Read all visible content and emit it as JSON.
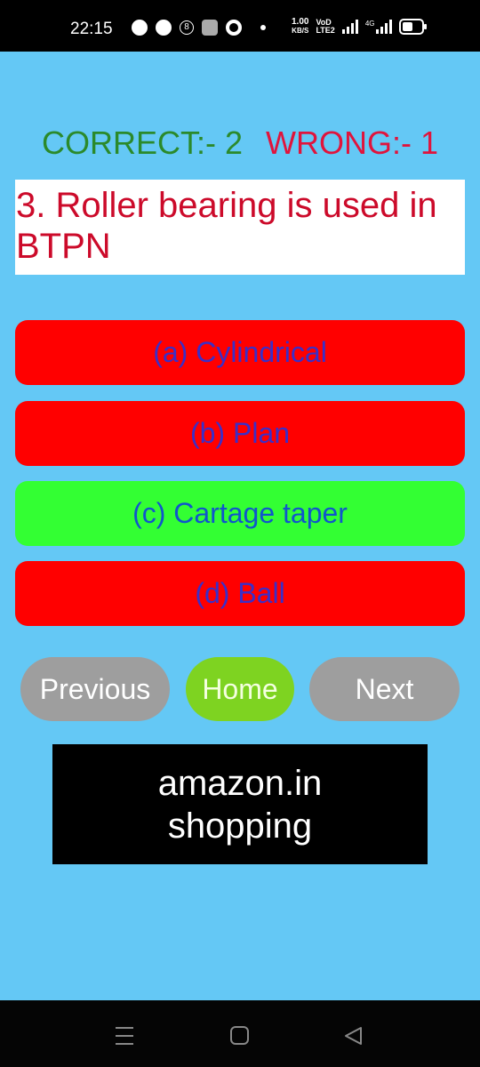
{
  "status_bar": {
    "time": "22:15",
    "net_speed_value": "1.00",
    "net_speed_unit": "KB/S",
    "volte_top": "VoD",
    "volte_bottom": "LTE2",
    "network_type": "4G"
  },
  "score": {
    "correct_label": "CORRECT:- 2",
    "wrong_label": "WRONG:- 1"
  },
  "question": {
    "text": "3.  Roller bearing is used in BTPN"
  },
  "options": [
    {
      "label": "(a) Cylindrical",
      "state": "wrong",
      "color": "#ff0000"
    },
    {
      "label": "(b) Plan",
      "state": "wrong",
      "color": "#ff0000"
    },
    {
      "label": "(c) Cartage taper",
      "state": "correct",
      "color": "#33ff33"
    },
    {
      "label": "(d) Ball",
      "state": "wrong",
      "color": "#ff0000"
    }
  ],
  "navigation": {
    "previous_label": "Previous",
    "home_label": "Home",
    "next_label": "Next"
  },
  "ad_banner": {
    "line1": "amazon.in",
    "line2": "shopping"
  },
  "colors": {
    "background": "#64c8f5",
    "correct_text": "#2b8a2b",
    "wrong_text": "#e0143c",
    "question_text": "#cc0a2a",
    "home_button": "#7ed321",
    "nav_button": "#9e9e9e"
  }
}
